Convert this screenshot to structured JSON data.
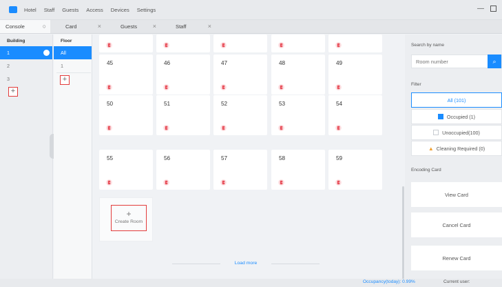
{
  "window": {
    "menu": [
      "Hotel",
      "Staff",
      "Guests",
      "Access",
      "Devices",
      "Settings"
    ],
    "minimize_icon": "minimize-icon",
    "maximize_icon": "maximize-icon"
  },
  "tabs": [
    {
      "label": "Console",
      "icon": "refresh-icon"
    },
    {
      "label": "Card",
      "icon": "close-icon"
    },
    {
      "label": "Guests",
      "icon": "close-icon"
    },
    {
      "label": "Staff",
      "icon": "close-icon"
    }
  ],
  "building": {
    "heading": "Building",
    "items": [
      "1",
      "2",
      "3"
    ],
    "selected": "1",
    "add_label": "+"
  },
  "floor": {
    "heading": "Floor",
    "items": [
      "All",
      "1"
    ],
    "selected": "All",
    "add_label": "+"
  },
  "rooms": {
    "row1": [
      "45",
      "46",
      "47",
      "48",
      "49"
    ],
    "row2": [
      "50",
      "51",
      "52",
      "53",
      "54"
    ],
    "row3": [
      "55",
      "56",
      "57",
      "58",
      "59"
    ],
    "status_icon": "door-icon",
    "status_color": "#e8505b"
  },
  "create_room": {
    "plus": "+",
    "label": "Create Room"
  },
  "load_more": "Load more",
  "search": {
    "label": "Search by name",
    "placeholder": "Room number",
    "button_icon": "search-icon"
  },
  "filter": {
    "label": "Filter",
    "all": "All (101)",
    "occupied": "Occupied (1)",
    "unoccupied": "Unoccupied(100)",
    "cleaning": "Cleaning Required (0)",
    "occupied_color": "#1a8cff",
    "cleaning_color": "#f0a030"
  },
  "encoding": {
    "label": "Encoding Card",
    "view": "View Card",
    "cancel": "Cancel Card",
    "renew": "Renew Card"
  },
  "status": {
    "occupancy": "Occupancy(today): 0.99%",
    "user": "Current user: "
  },
  "colors": {
    "accent": "#1a8cff",
    "highlight_box": "#e23b3b"
  }
}
